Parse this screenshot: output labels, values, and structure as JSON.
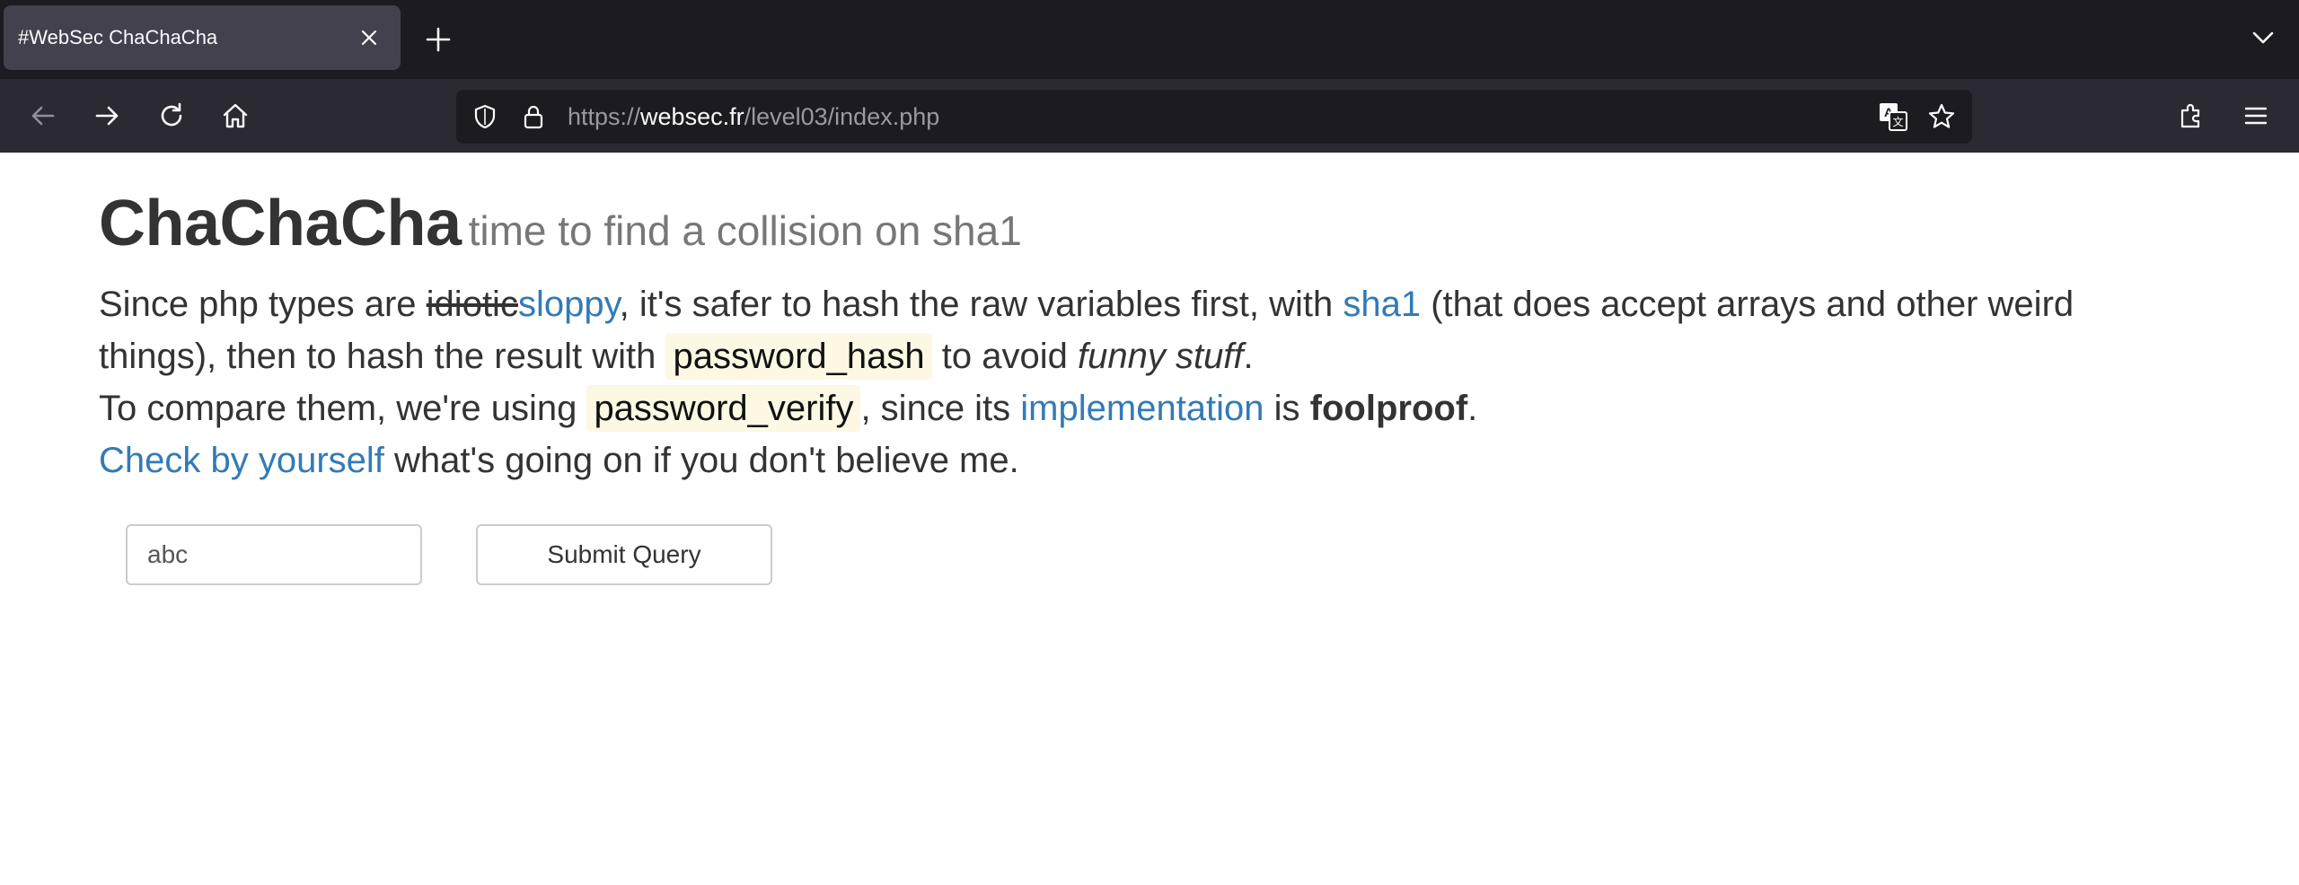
{
  "browser": {
    "tab": {
      "title": "#WebSec ChaChaCha"
    },
    "url": {
      "scheme": "https://",
      "host": "websec.fr",
      "path": "/level03/index.php"
    },
    "icons": {
      "close": "close-icon",
      "new_tab": "plus-icon",
      "tab_list": "chevron-down-icon",
      "back": "arrow-left-icon",
      "forward": "arrow-right-icon",
      "reload": "reload-icon",
      "home": "home-icon",
      "tracking": "shield-icon",
      "lock": "lock-icon",
      "translate": "translate-icon",
      "bookmark": "star-icon",
      "extensions": "puzzle-icon",
      "menu": "hamburger-menu-icon"
    },
    "colors": {
      "tabstrip": "#1c1b22",
      "navbar": "#2b2a33",
      "active_tab": "#42414d"
    }
  },
  "page": {
    "title": "ChaChaCha",
    "subtitle": "time to find a collision on sha1",
    "p1": {
      "t1": "Since php types are ",
      "strike": "idiotic",
      "link_sloppy": "sloppy",
      "t2": ", it's safer to hash the raw variables first, with ",
      "link_sha1": "sha1",
      "t3": " (that does accept arrays and other weird things), then to hash the result with ",
      "code_hash": "password_hash",
      "t4": " to avoid ",
      "em": "funny stuff",
      "t5": "."
    },
    "p2": {
      "t1": "To compare them, we're using ",
      "code_verify": "password_verify",
      "t2": ", since its ",
      "link_impl": "implementation",
      "t3": " is ",
      "strong": "foolproof",
      "t4": "."
    },
    "p3": {
      "link_check": "Check by yourself",
      "t1": " what's going on if you don't believe me."
    },
    "form": {
      "input_value": "abc",
      "submit_label": "Submit Query"
    },
    "colors": {
      "link": "#337ab7",
      "code_bg": "#fcf8e3",
      "text": "#333333",
      "subtitle": "#777777"
    }
  }
}
